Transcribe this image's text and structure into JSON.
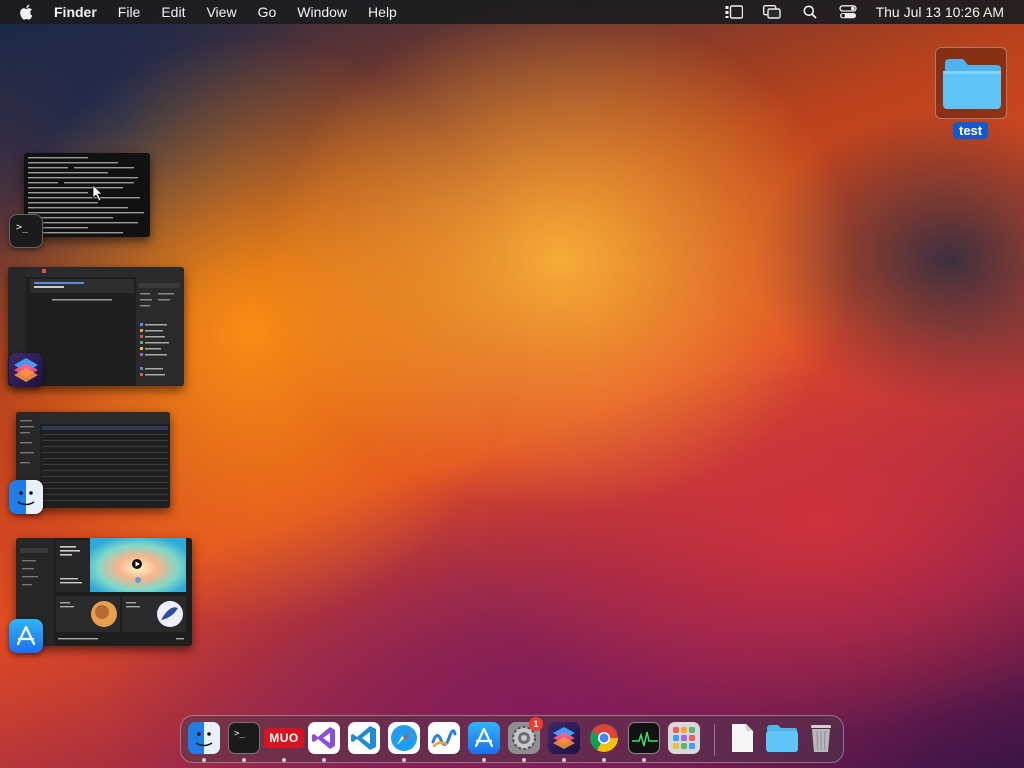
{
  "menubar": {
    "app_name": "Finder",
    "items": [
      "File",
      "Edit",
      "View",
      "Go",
      "Window"
    ],
    "help": "Help",
    "clock": "Thu Jul 13  10:26 AM",
    "icons": [
      "apple-icon",
      "stage-manager-icon",
      "screen-mirroring-icon",
      "search-icon",
      "control-center-icon"
    ]
  },
  "desktop": {
    "folder_name": "test"
  },
  "stage_windows": [
    "terminal",
    "shortcuts",
    "finder",
    "app-store"
  ],
  "dock": {
    "apps": [
      "finder",
      "terminal",
      "muo",
      "visual-studio",
      "vscode",
      "safari",
      "freeform",
      "app-store",
      "system-settings",
      "shortcuts",
      "chrome",
      "activity-monitor",
      "launchpad"
    ],
    "running": [
      "finder",
      "terminal",
      "muo",
      "visual-studio",
      "safari",
      "app-store",
      "system-settings",
      "shortcuts",
      "chrome",
      "activity-monitor"
    ],
    "right": [
      "document",
      "folder",
      "trash"
    ],
    "muo_label": "MUO",
    "settings_badge": "1"
  },
  "colors": {
    "accent": "#1458c9",
    "menubar": "#1c1c20",
    "badge": "#f23b30"
  }
}
